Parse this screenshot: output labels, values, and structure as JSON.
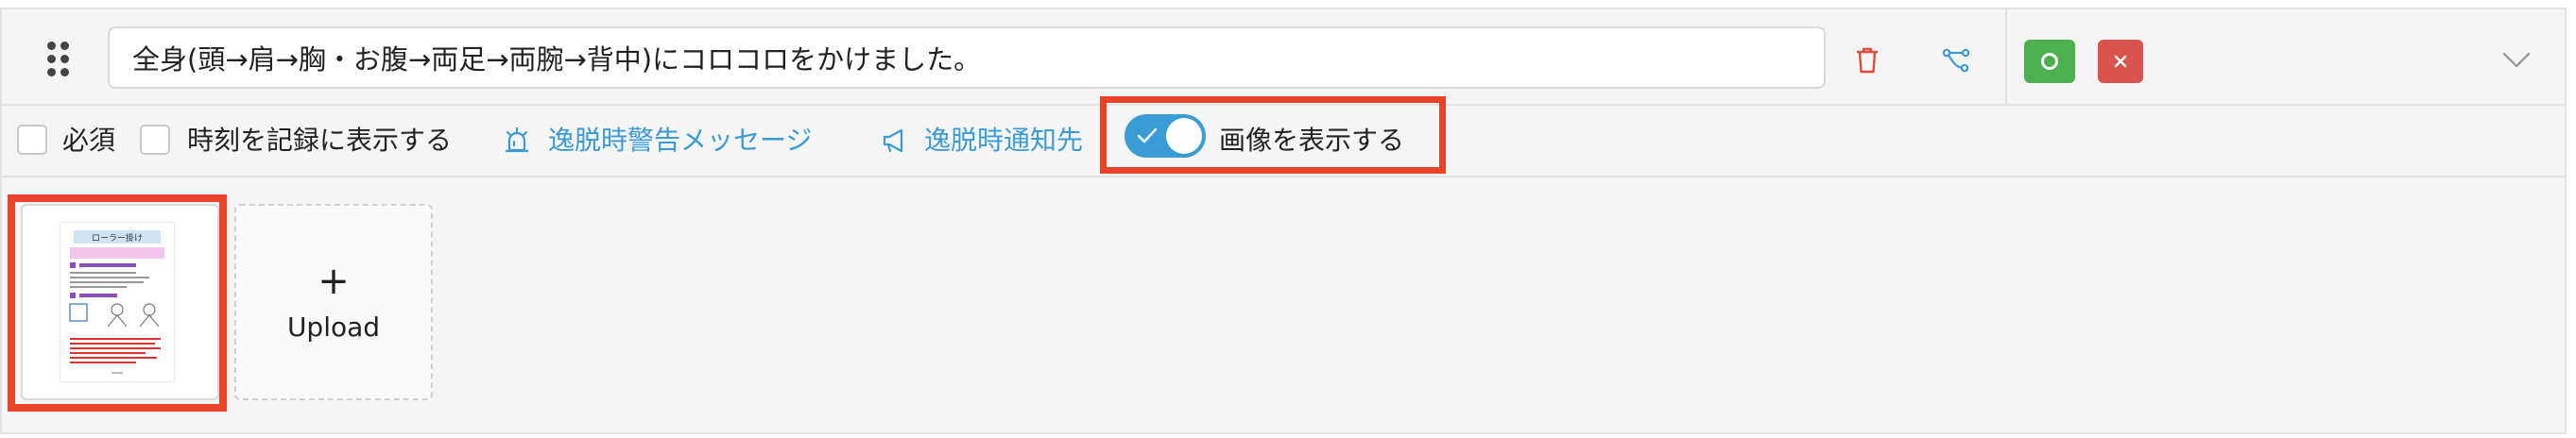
{
  "header": {
    "title_value": "全身(頭→肩→胸・お腹→両足→両腕→背中)にコロコロをかけました。"
  },
  "options": {
    "required_label": "必須",
    "time_label": "時刻を記録に表示する",
    "warning_link": "逸脱時警告メッセージ",
    "notify_link": "逸脱時通知先",
    "show_image_label": "画像を表示する",
    "show_image_on": true
  },
  "images": {
    "thumbnail_title": "ローラー掛け",
    "upload_plus": "+",
    "upload_label": "Upload"
  },
  "colors": {
    "accent": "#3a9bd5",
    "ok": "#4caf50",
    "ng": "#d9534f",
    "highlight": "#e8442a",
    "trash": "#e04b3c"
  },
  "icons": {
    "drag": "drag-handle-icon",
    "trash": "trash-icon",
    "branch": "branch-icon",
    "ok": "circle-icon",
    "ng": "close-icon",
    "expand": "chevron-down-icon",
    "warning": "alarm-icon",
    "notify": "megaphone-icon",
    "toggle_check": "check-icon"
  }
}
